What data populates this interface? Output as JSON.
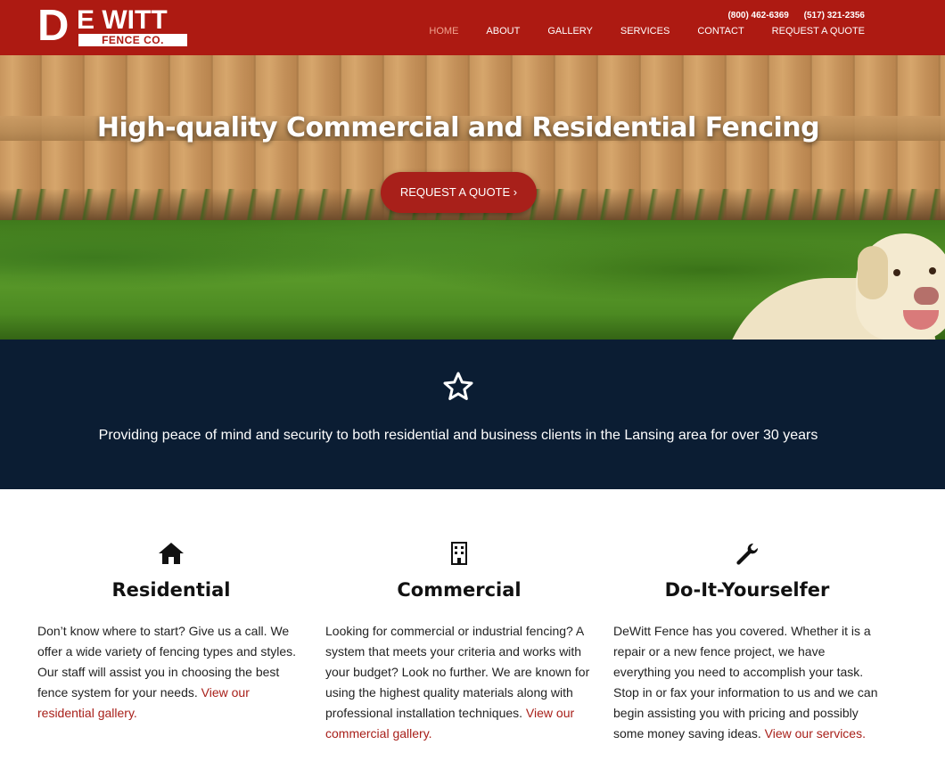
{
  "header": {
    "logo": {
      "d": "D",
      "ewitt": "E WITT",
      "sub": "FENCE CO."
    },
    "phones": [
      "(800) 462-6369",
      "(517) 321-2356"
    ],
    "nav": [
      "HOME",
      "ABOUT",
      "GALLERY",
      "SERVICES",
      "CONTACT",
      "REQUEST A QUOTE"
    ],
    "active_nav": "HOME"
  },
  "hero": {
    "title": "High-quality Commercial and Residential Fencing",
    "cta": "REQUEST A QUOTE ›"
  },
  "banner": {
    "icon": "star-outline-icon",
    "tagline": "Providing peace of mind and security to both residential and business clients in the Lansing area for over 30 years"
  },
  "features": [
    {
      "icon": "house-icon",
      "title": "Residential",
      "body": "Don’t know where to start?  Give us a call. We offer a wide variety of fencing types and styles.  Our staff will assist you in choosing the best fence system for your needs. ",
      "link": "View our residential gallery."
    },
    {
      "icon": "building-icon",
      "title": "Commercial",
      "body": "Looking for commercial or industrial fencing? A system that meets your criteria and works with your budget? Look no further. We are known for using the highest quality materials along with professional installation techniques. ",
      "link": "View our commercial gallery."
    },
    {
      "icon": "wrench-icon",
      "title": "Do-It-Yourselfer",
      "body": "DeWitt Fence has you covered. Whether it is a repair or a new fence project, we have everything you need to accomplish your task.  Stop in or fax your information to us and we can begin assisting you with pricing and possibly some money saving ideas. ",
      "link": "View our services."
    }
  ],
  "colors": {
    "brand_red": "#ad1a12",
    "navy": "#0b1d33",
    "link_red": "#a8201a"
  }
}
